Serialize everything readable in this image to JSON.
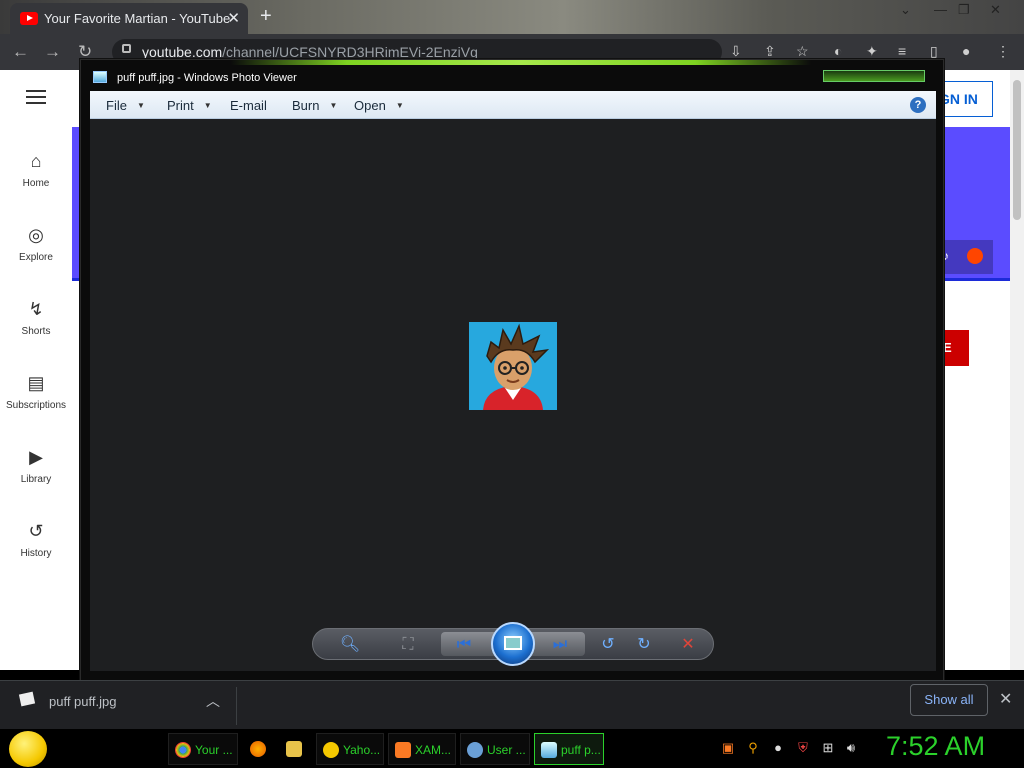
{
  "browser": {
    "tab_title": "Your Favorite Martian - YouTube",
    "url_host": "youtube.com",
    "url_path": "/channel/UCFSNYRD3HRimEVi-2EnziVg",
    "new_tab": "+",
    "tab_close": "✕"
  },
  "youtube": {
    "sign_in": "GN IN",
    "subscribe": "E",
    "sidebar": [
      {
        "label": "Home",
        "icon": "⌂"
      },
      {
        "label": "Explore",
        "icon": "◎"
      },
      {
        "label": "Shorts",
        "icon": "↯"
      },
      {
        "label": "Subscriptions",
        "icon": "▤"
      },
      {
        "label": "Library",
        "icon": "▶"
      },
      {
        "label": "History",
        "icon": "↺"
      }
    ]
  },
  "photo_viewer": {
    "title": "puff puff.jpg - Windows Photo Viewer",
    "menu": [
      "File",
      "Print",
      "E-mail",
      "Burn",
      "Open"
    ],
    "help": "?"
  },
  "downloads": {
    "file_name": "puff puff.jpg",
    "show_all": "Show all",
    "close": "✕"
  },
  "taskbar": {
    "items": [
      "Your ...",
      "",
      "",
      "Yaho...",
      "XAM...",
      "User ...",
      "puff p..."
    ],
    "clock": "7:52 AM"
  }
}
